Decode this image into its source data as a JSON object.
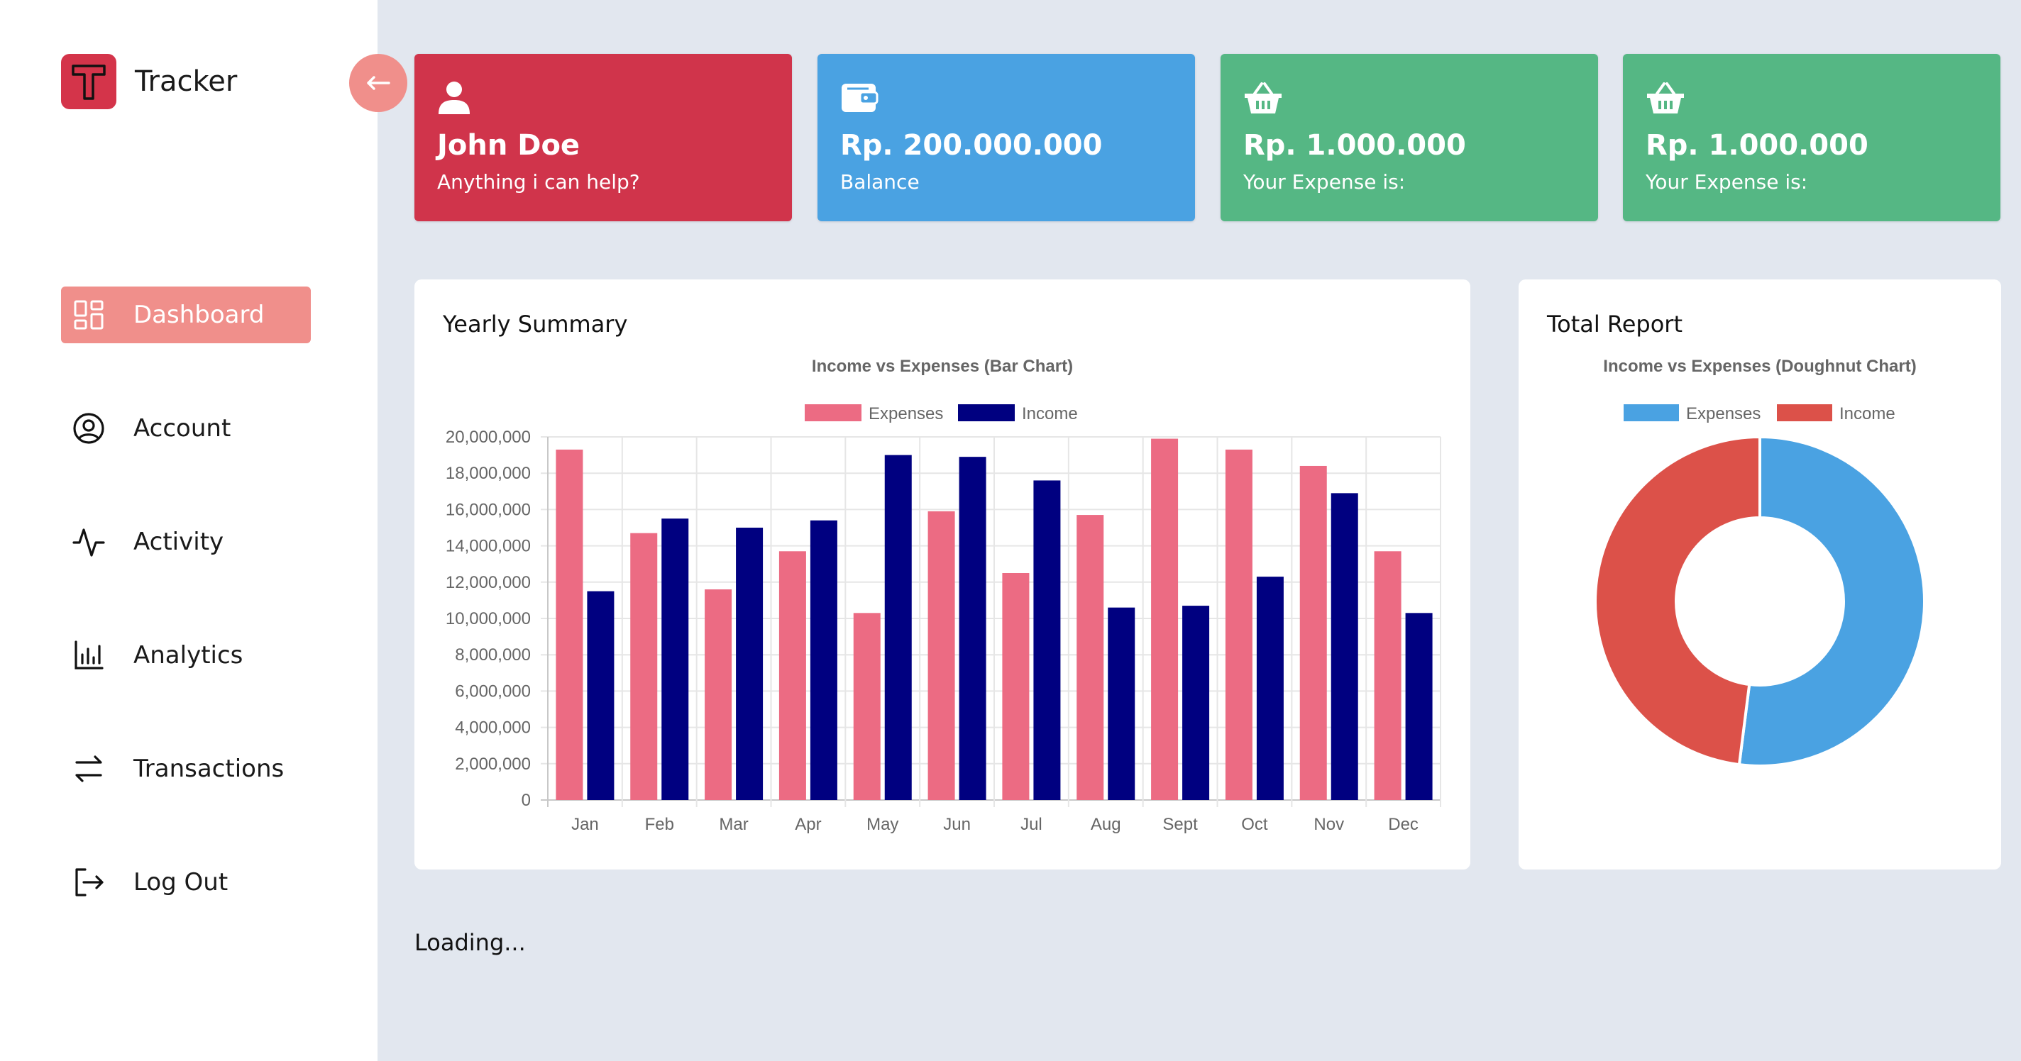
{
  "sidebar": {
    "brand": {
      "name": "Tracker",
      "logo_letter": "T"
    },
    "items": [
      {
        "label": "Dashboard",
        "icon": "dashboard-icon",
        "active": true
      },
      {
        "label": "Account",
        "icon": "user-circle-icon",
        "active": false
      },
      {
        "label": "Activity",
        "icon": "activity-icon",
        "active": false
      },
      {
        "label": "Analytics",
        "icon": "bar-chart-icon",
        "active": false
      },
      {
        "label": "Transactions",
        "icon": "swap-icon",
        "active": false
      },
      {
        "label": "Log Out",
        "icon": "logout-icon",
        "active": false
      }
    ]
  },
  "cards": [
    {
      "title": "John Doe",
      "subtitle": "Anything i can help?",
      "icon": "user-icon",
      "color": "#d0344b"
    },
    {
      "title": "Rp. 200.000.000",
      "subtitle": "Balance",
      "icon": "wallet-icon",
      "color": "#4aa2e2"
    },
    {
      "title": "Rp. 1.000.000",
      "subtitle": "Your Expense is:",
      "icon": "basket-icon",
      "color": "#55b784"
    },
    {
      "title": "Rp. 1.000.000",
      "subtitle": "Your Expense is:",
      "icon": "basket-icon",
      "color": "#55b784"
    }
  ],
  "yearly_panel": {
    "title": "Yearly Summary"
  },
  "total_panel": {
    "title": "Total Report"
  },
  "loading_text": "Loading...",
  "colors": {
    "accent": "#f08f8b",
    "expenses_bar": "#ec6b83",
    "income_bar": "#000080",
    "pie_expenses": "#4aa2e2",
    "pie_income": "#dc5149"
  },
  "chart_data": [
    {
      "type": "bar",
      "title": "Income vs Expenses (Bar Chart)",
      "categories": [
        "Jan",
        "Feb",
        "Mar",
        "Apr",
        "May",
        "Jun",
        "Jul",
        "Aug",
        "Sept",
        "Oct",
        "Nov",
        "Dec"
      ],
      "series": [
        {
          "name": "Expenses",
          "color": "#ec6b83",
          "values": [
            19300000,
            14700000,
            11600000,
            13700000,
            10300000,
            15900000,
            12500000,
            15700000,
            19900000,
            19300000,
            18400000,
            13700000
          ]
        },
        {
          "name": "Income",
          "color": "#000080",
          "values": [
            11500000,
            15500000,
            15000000,
            15400000,
            19000000,
            18900000,
            17600000,
            10600000,
            10700000,
            12300000,
            16900000,
            10300000
          ]
        }
      ],
      "ylim": [
        0,
        20000000
      ],
      "yticks": [
        "0",
        "2,000,000",
        "4,000,000",
        "6,000,000",
        "8,000,000",
        "10,000,000",
        "12,000,000",
        "14,000,000",
        "16,000,000",
        "18,000,000",
        "20,000,000"
      ],
      "grid": true,
      "legend": "top-center"
    },
    {
      "type": "pie",
      "title": "Income vs Expenses (Doughnut Chart)",
      "labels": [
        "Expenses",
        "Income"
      ],
      "values": [
        52,
        48
      ],
      "colors": [
        "#4aa2e2",
        "#dc5149"
      ],
      "legend": "top-center"
    }
  ]
}
